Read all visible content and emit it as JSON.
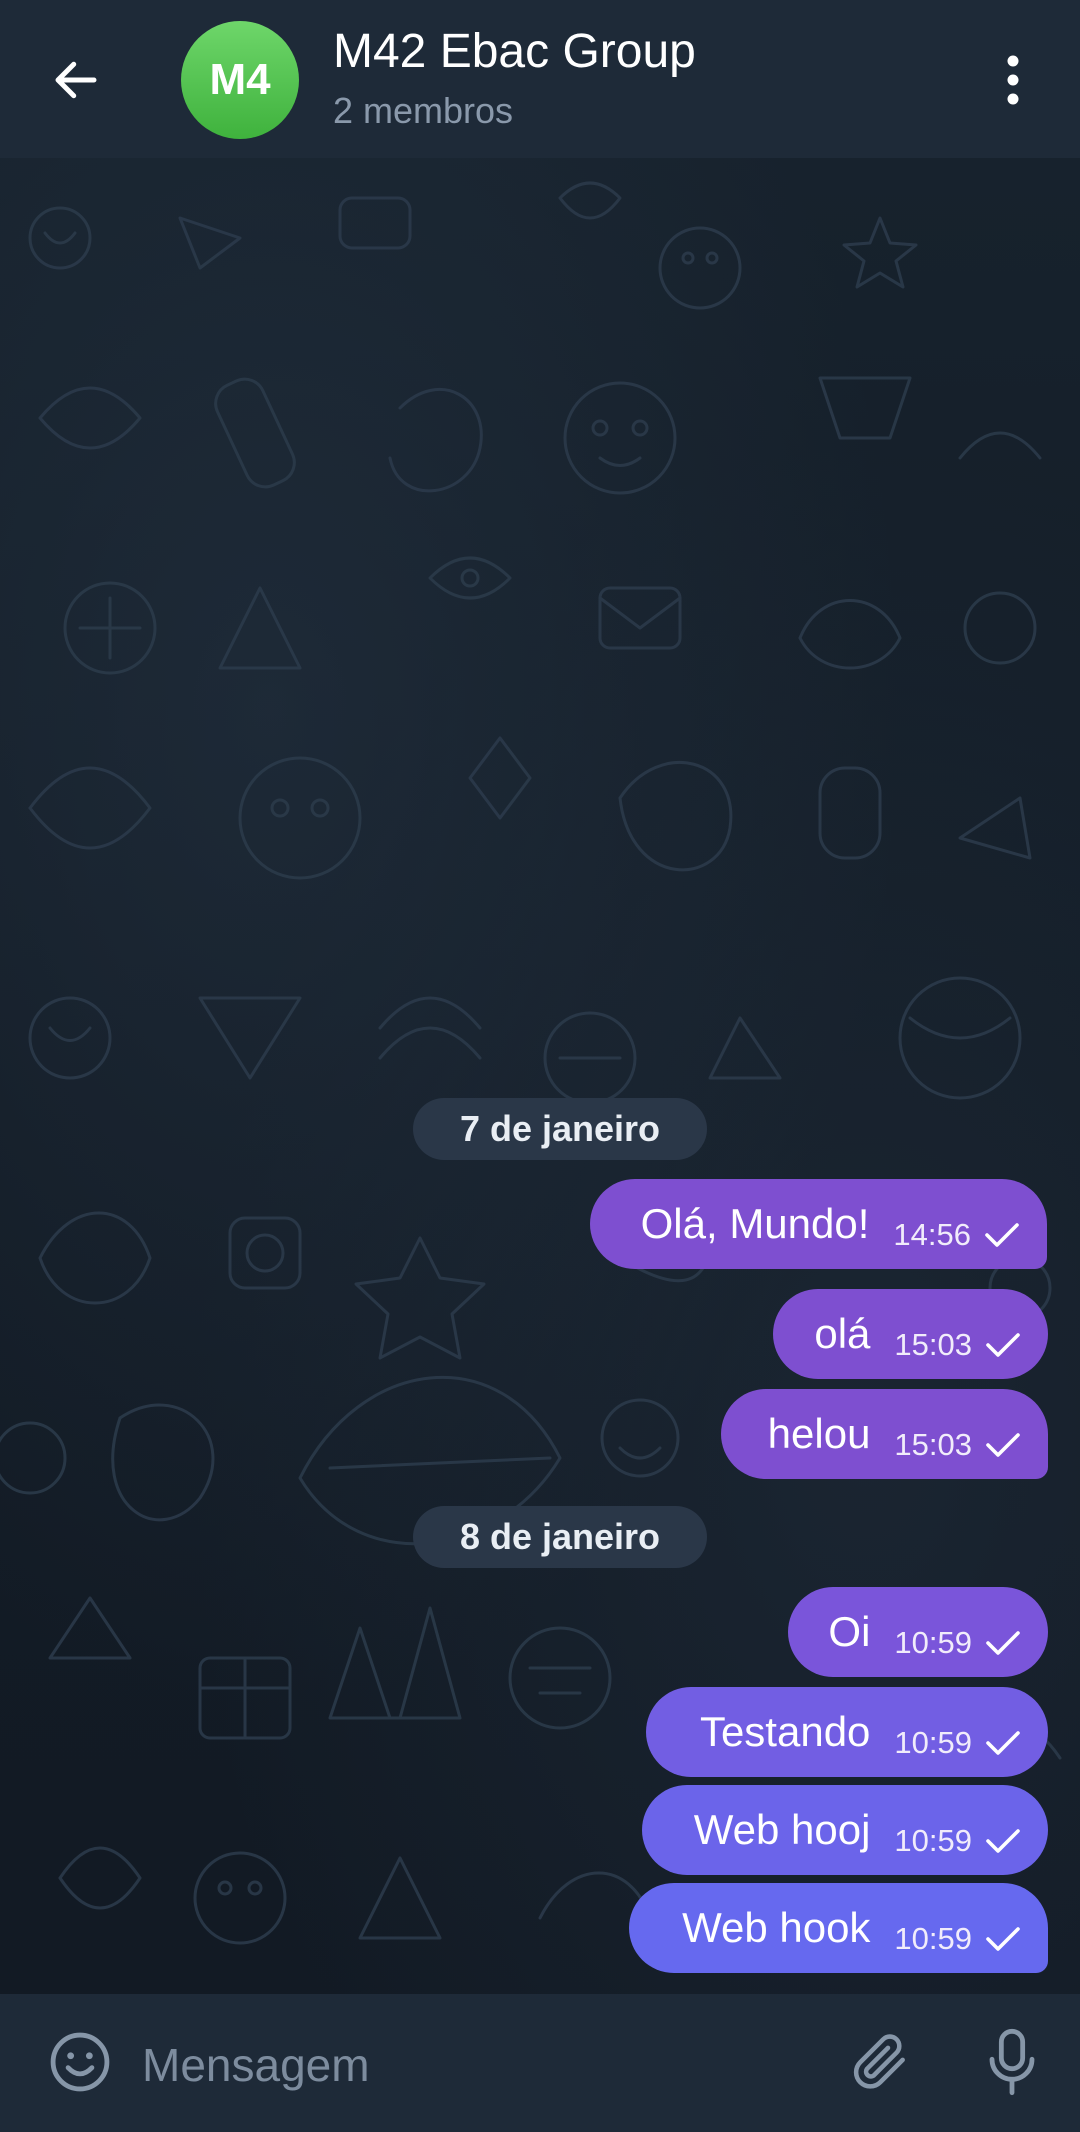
{
  "header": {
    "avatar_initials": "M4",
    "title": "M42 Ebac Group",
    "subtitle": "2 membros",
    "avatar_color": "#4cc44a"
  },
  "messages": [
    {
      "type": "date",
      "label": "7 de janeiro"
    },
    {
      "type": "message",
      "text": "Olá, Mundo!",
      "time": "14:56",
      "status": "sent",
      "color": "#7e4fd0"
    },
    {
      "type": "message",
      "text": "olá",
      "time": "15:03",
      "status": "sent",
      "color": "#7e4fd0"
    },
    {
      "type": "message",
      "text": "helou",
      "time": "15:03",
      "status": "sent",
      "color": "#7e4fd0"
    },
    {
      "type": "date",
      "label": "8 de janeiro"
    },
    {
      "type": "message",
      "text": "Oi",
      "time": "10:59",
      "status": "sent",
      "color": "#7a55da"
    },
    {
      "type": "message",
      "text": "Testando",
      "time": "10:59",
      "status": "sent",
      "color": "#725ee3"
    },
    {
      "type": "message",
      "text": "Web hooj",
      "time": "10:59",
      "status": "sent",
      "color": "#6b64ea"
    },
    {
      "type": "message",
      "text": "Web hook",
      "time": "10:59",
      "status": "sent",
      "color": "#6669ef"
    }
  ],
  "input": {
    "placeholder": "Mensagem",
    "value": ""
  },
  "icons": {
    "back": "arrow-left-icon",
    "menu": "more-vertical-icon",
    "emoji": "smile-icon",
    "attach": "paperclip-icon",
    "mic": "microphone-icon",
    "status": "check-icon"
  }
}
